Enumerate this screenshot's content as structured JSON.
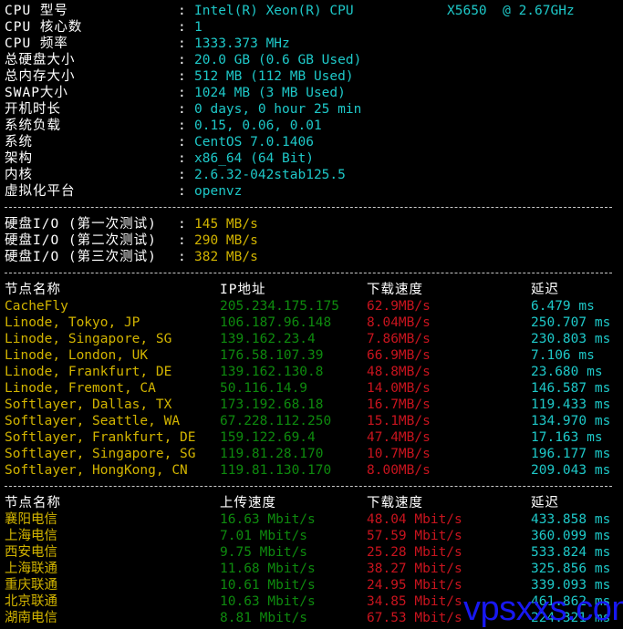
{
  "system_info": [
    {
      "label": "CPU 型号",
      "value": "Intel(R) Xeon(R) CPU",
      "value_extra": "X5650  @ 2.67GHz"
    },
    {
      "label": "CPU 核心数",
      "value": "1"
    },
    {
      "label": "CPU 频率",
      "value": "1333.373 MHz"
    },
    {
      "label": "总硬盘大小",
      "value": "20.0 GB (0.6 GB Used)"
    },
    {
      "label": "总内存大小",
      "value": "512 MB (112 MB Used)"
    },
    {
      "label": "SWAP大小",
      "value": "1024 MB (3 MB Used)"
    },
    {
      "label": "开机时长",
      "value": "0 days, 0 hour 25 min"
    },
    {
      "label": "系统负载",
      "value": "0.15, 0.06, 0.01"
    },
    {
      "label": "系统",
      "value": "CentOS 7.0.1406"
    },
    {
      "label": "架构",
      "value": "x86_64 (64 Bit)"
    },
    {
      "label": "内核",
      "value": "2.6.32-042stab125.5"
    },
    {
      "label": "虚拟化平台",
      "value": "openvz"
    }
  ],
  "colon": ":",
  "disk_io": [
    {
      "label": "硬盘I/O (第一次测试)",
      "value": "145 MB/s"
    },
    {
      "label": "硬盘I/O (第二次测试)",
      "value": "290 MB/s"
    },
    {
      "label": "硬盘I/O (第三次测试)",
      "value": "382 MB/s"
    }
  ],
  "intl_speedtest": {
    "headers": {
      "node": "节点名称",
      "ip": "IP地址",
      "download": "下载速度",
      "latency": "延迟"
    },
    "rows": [
      {
        "node": "CacheFly",
        "ip": "205.234.175.175",
        "download": "62.9MB/s",
        "latency": "6.479 ms"
      },
      {
        "node": "Linode, Tokyo, JP",
        "ip": "106.187.96.148",
        "download": "8.04MB/s",
        "latency": "250.707 ms"
      },
      {
        "node": "Linode, Singapore, SG",
        "ip": "139.162.23.4",
        "download": "7.86MB/s",
        "latency": "230.803 ms"
      },
      {
        "node": "Linode, London, UK",
        "ip": "176.58.107.39",
        "download": "66.9MB/s",
        "latency": "7.106 ms"
      },
      {
        "node": "Linode, Frankfurt, DE",
        "ip": "139.162.130.8",
        "download": "48.8MB/s",
        "latency": "23.680 ms"
      },
      {
        "node": "Linode, Fremont, CA",
        "ip": "50.116.14.9",
        "download": "14.0MB/s",
        "latency": "146.587 ms"
      },
      {
        "node": "Softlayer, Dallas, TX",
        "ip": "173.192.68.18",
        "download": "16.7MB/s",
        "latency": "119.433 ms"
      },
      {
        "node": "Softlayer, Seattle, WA",
        "ip": "67.228.112.250",
        "download": "15.1MB/s",
        "latency": "134.970 ms"
      },
      {
        "node": "Softlayer, Frankfurt, DE",
        "ip": "159.122.69.4",
        "download": "47.4MB/s",
        "latency": "17.163 ms"
      },
      {
        "node": "Softlayer, Singapore, SG",
        "ip": "119.81.28.170",
        "download": "10.7MB/s",
        "latency": "196.177 ms"
      },
      {
        "node": "Softlayer, HongKong, CN",
        "ip": "119.81.130.170",
        "download": "8.00MB/s",
        "latency": "209.043 ms"
      }
    ]
  },
  "cn_speedtest": {
    "headers": {
      "node": "节点名称",
      "upload": "上传速度",
      "download": "下载速度",
      "latency": "延迟"
    },
    "rows": [
      {
        "node": "襄阳电信",
        "upload": "16.63 Mbit/s",
        "download": "48.04 Mbit/s",
        "latency": "433.858 ms"
      },
      {
        "node": "上海电信",
        "upload": "7.01 Mbit/s",
        "download": "57.59 Mbit/s",
        "latency": "360.099 ms"
      },
      {
        "node": "西安电信",
        "upload": "9.75 Mbit/s",
        "download": "25.28 Mbit/s",
        "latency": "533.824 ms"
      },
      {
        "node": "上海联通",
        "upload": "11.68 Mbit/s",
        "download": "38.27 Mbit/s",
        "latency": "325.856 ms"
      },
      {
        "node": "重庆联通",
        "upload": "10.61 Mbit/s",
        "download": "24.95 Mbit/s",
        "latency": "339.093 ms"
      },
      {
        "node": "北京联通",
        "upload": "10.63 Mbit/s",
        "download": "34.85 Mbit/s",
        "latency": "461.862 ms"
      },
      {
        "node": "湖南电信",
        "upload": "8.81 Mbit/s",
        "download": "67.53 Mbit/s",
        "latency": "224.321 ms"
      }
    ]
  },
  "watermark": "vpsxxs.com",
  "colors": {
    "background": "#000000",
    "label": "#ffffff",
    "value": "#1ec8c8",
    "io_value": "#d2b400",
    "node": "#d2b400",
    "ip_upload": "#0e8a0e",
    "download": "#c8141e",
    "latency": "#1ec8c8",
    "watermark": "#1a1aff"
  }
}
